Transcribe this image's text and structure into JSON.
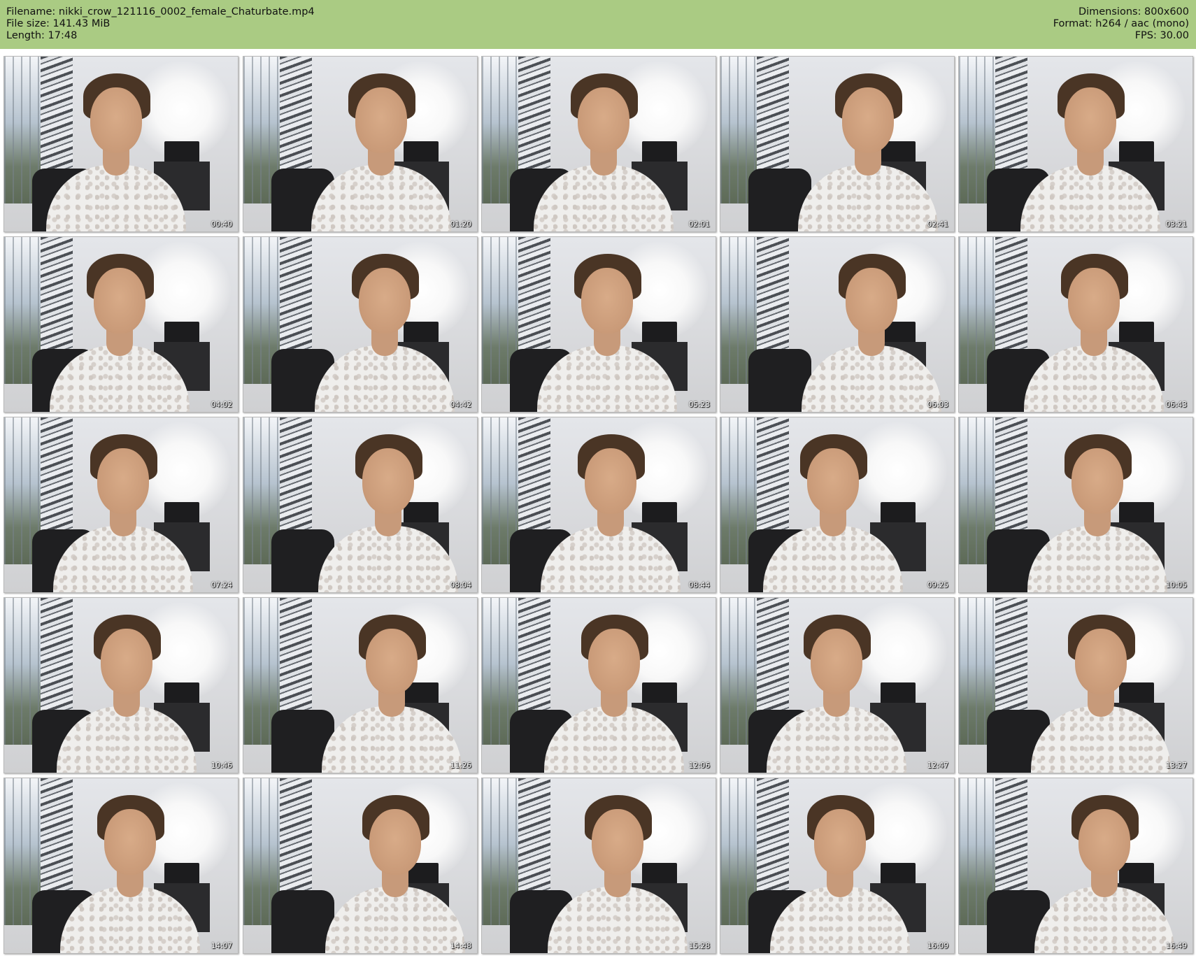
{
  "header": {
    "filename": "Filename: nikki_crow_121116_0002_female_Chaturbate.mp4",
    "file_size": "File size: 141.43 MiB",
    "length": "Length: 17:48",
    "dimensions": "Dimensions: 800x600",
    "format": "Format: h264 / aac (mono)",
    "fps": "FPS: 30.00"
  },
  "thumbnails": [
    {
      "time": "00:40"
    },
    {
      "time": "01:20"
    },
    {
      "time": "02:01"
    },
    {
      "time": "02:41"
    },
    {
      "time": "03:21"
    },
    {
      "time": "04:02"
    },
    {
      "time": "04:42"
    },
    {
      "time": "05:23"
    },
    {
      "time": "06:03"
    },
    {
      "time": "06:43"
    },
    {
      "time": "07:24"
    },
    {
      "time": "08:04"
    },
    {
      "time": "08:44"
    },
    {
      "time": "09:25"
    },
    {
      "time": "10:05"
    },
    {
      "time": "10:46"
    },
    {
      "time": "11:26"
    },
    {
      "time": "12:06"
    },
    {
      "time": "12:47"
    },
    {
      "time": "13:27"
    },
    {
      "time": "14:07"
    },
    {
      "time": "14:48"
    },
    {
      "time": "15:28"
    },
    {
      "time": "16:09"
    },
    {
      "time": "16:49"
    }
  ],
  "colors": {
    "header_bg": "#aacb83",
    "page_bg": "#ffffff",
    "timestamp": "#ffffff"
  }
}
